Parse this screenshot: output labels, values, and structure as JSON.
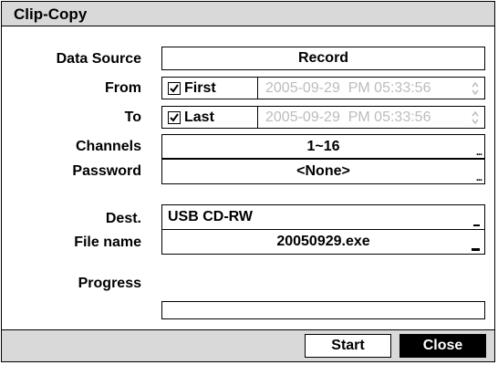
{
  "dialog": {
    "title": "Clip-Copy"
  },
  "fields": {
    "data_source": {
      "label": "Data Source",
      "value": "Record"
    },
    "from": {
      "label": "From",
      "checkbox_label": "First",
      "checked": true,
      "datetime": "2005-09-29  PM 05:33:56"
    },
    "to": {
      "label": "To",
      "checkbox_label": "Last",
      "checked": true,
      "datetime": "2005-09-29  PM 05:33:56"
    },
    "channels": {
      "label": "Channels",
      "value": "1~16"
    },
    "password": {
      "label": "Password",
      "value": "<None>"
    },
    "dest": {
      "label": "Dest.",
      "value": "USB CD-RW"
    },
    "file_name": {
      "label": "File name",
      "value": "20050929.exe"
    },
    "progress": {
      "label": "Progress",
      "value_fraction": 0
    }
  },
  "buttons": {
    "start": "Start",
    "close": "Close"
  },
  "icons": {
    "ellipsis": "ellipsis-icon",
    "dropdown": "dropdown-icon",
    "spinner": "spinner-icon",
    "check": "checkmark-icon"
  },
  "colors": {
    "titlebar_bg": "#d9d9d9",
    "disabled_text": "#bcbcbc",
    "close_button_bg": "#000000"
  }
}
